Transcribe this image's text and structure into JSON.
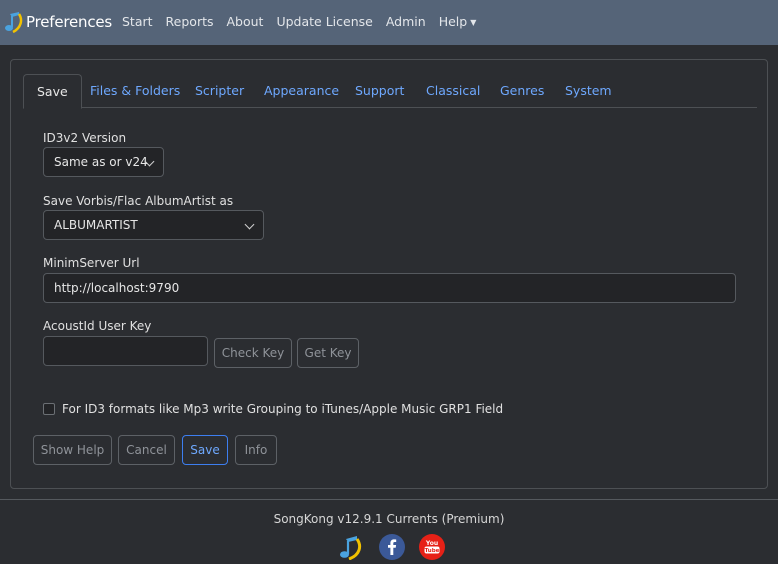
{
  "navbar": {
    "brand": "Preferences",
    "items": [
      {
        "label": "Start"
      },
      {
        "label": "Reports"
      },
      {
        "label": "About"
      },
      {
        "label": "Update License"
      },
      {
        "label": "Admin"
      },
      {
        "label": "Help"
      }
    ]
  },
  "tabs": [
    {
      "label": "Save",
      "active": true
    },
    {
      "label": "Files & Folders"
    },
    {
      "label": "Scripter"
    },
    {
      "label": "Appearance"
    },
    {
      "label": "Support"
    },
    {
      "label": "Classical"
    },
    {
      "label": "Genres"
    },
    {
      "label": "System"
    }
  ],
  "form": {
    "id3_label": "ID3v2 Version",
    "id3_value": "Same as or v24",
    "vorbis_label": "Save Vorbis/Flac AlbumArtist as",
    "vorbis_value": "ALBUMARTIST",
    "minim_label": "MinimServer Url",
    "minim_value": "http://localhost:9790",
    "acoust_label": "AcoustId User Key",
    "acoust_value": "",
    "check_key": "Check Key",
    "get_key": "Get Key",
    "grouping_label": "For ID3 formats like Mp3 write Grouping to iTunes/Apple Music GRP1 Field",
    "grouping_checked": false
  },
  "actions": {
    "show_help": "Show Help",
    "cancel": "Cancel",
    "save": "Save",
    "info": "Info"
  },
  "footer": {
    "version": "SongKong v12.9.1 Currents (Premium)"
  },
  "colors": {
    "navbar": "#556478",
    "background": "#2b2d31",
    "link": "#6ea8fe",
    "facebook": "#3b5998",
    "youtube": "#e62117"
  }
}
